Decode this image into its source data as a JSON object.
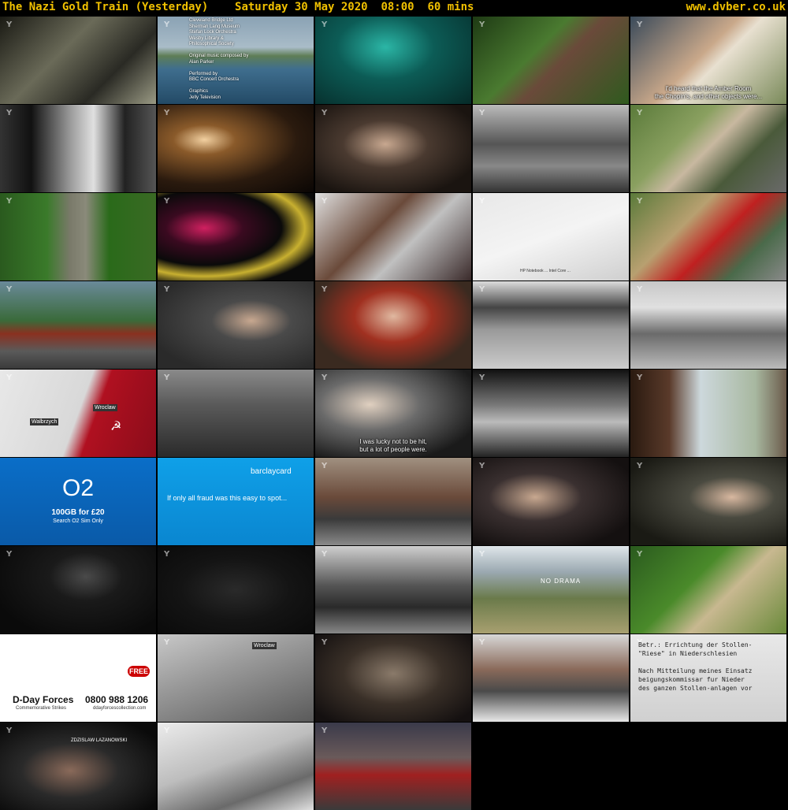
{
  "header": {
    "title": "The Nazi Gold Train (Yesterday)",
    "date": "Saturday 30 May 2020",
    "time": "08:00",
    "duration": "60 mins",
    "site": "www.dvber.co.uk"
  },
  "colors": {
    "header_text": "#f0c000",
    "background": "#000000"
  },
  "thumbnails": [
    {
      "bg": "linear-gradient(135deg,#1a1a14,#6a6a58 40%,#2a2a24 70%,#9a9a84)"
    },
    {
      "bg": "linear-gradient(180deg,#8aa2b4 0%,#a9bcc8 35%,#5f7e56 45%,#3f6e8e 60%,#234a66 100%)",
      "credits": [
        "Cleveland Bridge Ltd",
        "Sherman Lang Museum",
        "Stefan Lock Orchestra",
        "Wesby Library &",
        "Philosophical Society",
        "",
        "Original music composed by",
        "Alan Parker",
        "",
        "Performed by",
        "BBC Concert Orchestra",
        "",
        "Graphics",
        "Jelly Television"
      ]
    },
    {
      "bg": "radial-gradient(ellipse at 45% 35%,#2bb6a6 0%,#0c5c56 40%,#062a28 100%)"
    },
    {
      "bg": "linear-gradient(135deg,#1e3a14,#4a7a30 40%,#6a4a3a 55%,#2f5a1e)"
    },
    {
      "bg": "linear-gradient(135deg,#3a4a5a,#c9a88a 45%,#e8e0d0 55%,#7a8a5a)",
      "subtitle": [
        "I'd heard that the Amber Room",
        "the Chopin's, and other objects were..."
      ]
    },
    {
      "bg": "linear-gradient(90deg,#333 0%,#111 20%,#9a9a9a 45%,#e0e0e0 60%,#222 80%,#555)"
    },
    {
      "bg": "radial-gradient(ellipse at 30% 40%,#f2d0a0 0%,#8a5a2a 20%,#2a1a0e 60%,#0a0604 100%)"
    },
    {
      "bg": "radial-gradient(ellipse at 45% 45%,#c8a890 0%,#4a3a30 35%,#1a1410 80%)"
    },
    {
      "bg": "linear-gradient(180deg,#bbb 0%,#555 45%,#888 70%,#333)"
    },
    {
      "bg": "linear-gradient(135deg,#5a7a3a,#8aa060 35%,#c8b8a0 50%,#4a5a3a 70%,#6a6a6a)"
    },
    {
      "bg": "linear-gradient(90deg,#2a5a1e 0%,#3a7a2a 30%,#7a7a6a 45%,#8a8a7a 55%,#2a6a1a 70%,#3a6a24)"
    },
    {
      "bg": "radial-gradient(ellipse at 30% 40%,#d02060 0%,#3a0a20 25%,#0a0a0a 50%,#c8b030 65%,#0a0a0a 80%)"
    },
    {
      "bg": "linear-gradient(135deg,#e0e0e0,#6a4a3a 40%,#c0c0c0 60%,#3a2a2a)"
    },
    {
      "bg": "linear-gradient(160deg,#e8e8e8 0%,#f4f4f4 50%,#cfcfcf 100%)",
      "small": "HP Notebook ... Intel Core ..."
    },
    {
      "bg": "linear-gradient(135deg,#5a7a3a,#b8a070 35%,#c02020 55%,#4a6a4a 75%,#8a8a8a)"
    },
    {
      "bg": "linear-gradient(180deg,#6a8a9a 0%,#3a6a3a 45%,#8a3020 60%,#5a5a5a 80%,#3a3a3a)"
    },
    {
      "bg": "radial-gradient(ellipse at 60% 45%,#c8a890 0%,#4a4a4a 30%,#2a2a2a 80%)"
    },
    {
      "bg": "radial-gradient(ellipse at 50% 40%,#e0b8a0 0%,#a03020 35%,#3a2a20 75%)"
    },
    {
      "bg": "linear-gradient(180deg,#ddd 0%,#444 30%,#999 55%,#ccc 100%)"
    },
    {
      "bg": "linear-gradient(180deg,#c8c8c8 0%,#e0e0e0 30%,#6a6a6a 60%,#bbb 100%)"
    },
    {
      "bg": "linear-gradient(110deg,#e8e8e8 0%,#d8d8d8 50%,#b01020 60%,#8a0c1a 100%)",
      "map": [
        "Walbrzych",
        "Wroclaw"
      ]
    },
    {
      "bg": "linear-gradient(180deg,#8a8a8a 0%,#5a5a5a 40%,#2a2a2a 100%)"
    },
    {
      "bg": "radial-gradient(ellipse at 35% 40%,#e0d0c0 0%,#6a6a6a 35%,#1a1a1a 80%)",
      "subtitle": [
        "I was lucky not to be hit,",
        "but a lot of people were."
      ]
    },
    {
      "bg": "linear-gradient(180deg,#111 0%,#777 40%,#bbb 60%,#222)"
    },
    {
      "bg": "linear-gradient(90deg,#2a1a10 0%,#5a3a2a 25%,#cdd8dc 45%,#a8b8a0 80%,#6a5a4a)"
    },
    {
      "bg": "linear-gradient(180deg,#0a6ec8 0%,#0a5aa8 100%)",
      "o2": [
        "O2",
        "100GB for £20",
        "Search O2 Sim Only"
      ]
    },
    {
      "bg": "linear-gradient(180deg,#0fa0e8 0%,#0a86d0 100%)",
      "barclay": [
        "barclaycard",
        "If only all fraud was this easy to spot..."
      ]
    },
    {
      "bg": "linear-gradient(180deg,#a09080 0%,#6a4a3a 45%,#3a3a3a 70%,#8a8a8a)"
    },
    {
      "bg": "radial-gradient(ellipse at 40% 45%,#c8a890 0%,#3a3030 35%,#141010 80%)"
    },
    {
      "bg": "radial-gradient(ellipse at 65% 45%,#d8b8a0 0%,#4a4a40 30%,#1a1a14 80%)"
    },
    {
      "bg": "radial-gradient(ellipse at 55% 35%,#4a4a4a 0%,#1a1a1a 30%,#0a0a0a 80%)"
    },
    {
      "bg": "radial-gradient(ellipse at 50% 50%,#2a2a2a 0%,#141414 50%,#0a0a0a)"
    },
    {
      "bg": "linear-gradient(180deg,#cfcfcf 0%,#555 45%,#2a2a2a 70%,#888)"
    },
    {
      "bg": "linear-gradient(180deg,#dfe6ea 0%,#9aa8b0 30%,#6a7a4a 60%,#a8a070)",
      "brand": "NO DRAMA"
    },
    {
      "bg": "linear-gradient(135deg,#2a5a1e 0%,#4a8a2a 40%,#c8b890 60%,#6a8a3a)"
    },
    {
      "bg": "linear-gradient(180deg,#ffffff 0%,#ffffff 100%)",
      "dday": [
        "D-Day Forces",
        "0800 988 1206",
        "Commemorative Strikes",
        "ddayforcescollection.com",
        "FREE"
      ]
    },
    {
      "bg": "linear-gradient(160deg,#c8c8c8 0%,#9a9a9a 40%,#5a5a5a 100%)",
      "mapcity": "Wroclaw"
    },
    {
      "bg": "radial-gradient(ellipse at 50% 45%,#8a7a6a 0%,#3a3028 45%,#141010 90%)"
    },
    {
      "bg": "linear-gradient(180deg,#d8d8d8 0%,#8a6a5a 40%,#4a4a4a 65%,#e8e8e8 100%)"
    },
    {
      "bg": "linear-gradient(180deg,#e8e8e8 0%,#d0d0d0 100%)",
      "doc": [
        "Betr.: Errichtung der Stollen-",
        "\"Riese\" in Niederschlesien",
        "",
        "Nach Mitteilung meines Einsatz",
        "beigungskommissar fur Nieder",
        "des ganzen Stollen-anlagen vor"
      ]
    },
    {
      "bg": "radial-gradient(ellipse at 45% 55%,#8a6a5a 0%,#2a2a2a 40%,#0a0a0a 85%)",
      "name": "ZDZISLAW LAZANOWSKI"
    },
    {
      "bg": "linear-gradient(160deg,#ececec 0%,#bdbdbd 45%,#6a6a6a 75%,#e0e0e0 100%)"
    },
    {
      "bg": "linear-gradient(180deg,#3a3a4a 0%,#6a5a5a 40%,#a02020 60%,#3a3a3a 100%)"
    }
  ]
}
